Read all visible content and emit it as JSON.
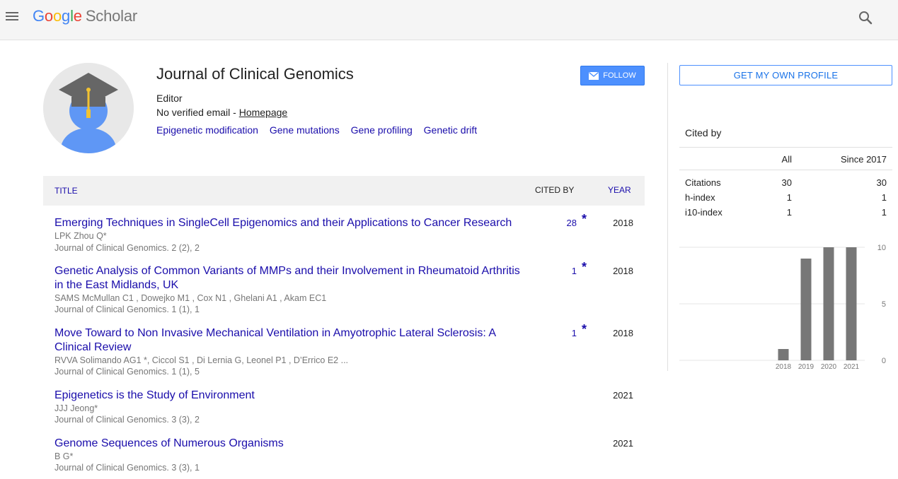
{
  "header": {
    "logo": [
      "G",
      "o",
      "o",
      "g",
      "l",
      "e"
    ],
    "logo_suffix": "Scholar",
    "menu_icon": "hamburger-menu-icon",
    "search_icon": "search-icon"
  },
  "profile": {
    "name": "Journal of Clinical Genomics",
    "affiliation": "Editor",
    "email_text": "No verified email - ",
    "homepage_label": "Homepage",
    "interests": [
      "Epigenetic modification",
      "Gene mutations",
      "Gene profiling",
      "Genetic drift"
    ],
    "follow_label": "FOLLOW",
    "get_profile_label": "GET MY OWN PROFILE"
  },
  "table": {
    "col_title": "TITLE",
    "col_cited_by": "CITED BY",
    "col_year": "YEAR"
  },
  "articles": [
    {
      "title": "Emerging Techniques in SingleCell Epigenomics and their Applications to Cancer Research",
      "authors": "LPK Zhou Q*",
      "venue": "Journal of Clinical Genomics. 2 (2), 2",
      "cited_by": "28",
      "star": "*",
      "year": "2018"
    },
    {
      "title": "Genetic Analysis of Common Variants of MMPs and their Involvement in Rheumatoid Arthritis in the East Midlands, UK",
      "authors": "SAMS McMullan C1 , Dowejko M1 , Cox N1 , Ghelani A1 , Akam EC1",
      "venue": "Journal of Clinical Genomics. 1 (1), 1",
      "cited_by": "1",
      "star": "*",
      "year": "2018"
    },
    {
      "title": "Move Toward to Non Invasive Mechanical Ventilation in Amyotrophic Lateral Sclerosis: A Clinical Review",
      "authors": "RVVA Solimando AG1 *, Ciccol S1 , Di Lernia G, Leonel P1 , D’Errico E2 ...",
      "venue": "Journal of Clinical Genomics. 1 (1), 5",
      "cited_by": "1",
      "star": "*",
      "year": "2018"
    },
    {
      "title": "Epigenetics is the Study of Environment",
      "authors": "JJJ Jeong*",
      "venue": "Journal of Clinical Genomics. 3 (3), 2",
      "cited_by": "",
      "star": "",
      "year": "2021"
    },
    {
      "title": "Genome Sequences of Numerous Organisms",
      "authors": "B G*",
      "venue": "Journal of Clinical Genomics. 3 (3), 1",
      "cited_by": "",
      "star": "",
      "year": "2021"
    }
  ],
  "cited_by": {
    "title": "Cited by",
    "col_all": "All",
    "col_since": "Since 2017",
    "rows": [
      {
        "label": "Citations",
        "all": "30",
        "since": "30"
      },
      {
        "label": "h-index",
        "all": "1",
        "since": "1"
      },
      {
        "label": "i10-index",
        "all": "1",
        "since": "1"
      }
    ]
  },
  "colors": {
    "link": "#1a0dab",
    "follow_bg": "#4d90fe",
    "bar": "#777777"
  },
  "chart_data": {
    "type": "bar",
    "categories": [
      "2018",
      "2019",
      "2020",
      "2021"
    ],
    "values": [
      1,
      9,
      10,
      10
    ],
    "ylim": [
      0,
      10
    ],
    "yticks": [
      "10",
      "5",
      "0"
    ],
    "title": "",
    "xlabel": "",
    "ylabel": ""
  }
}
